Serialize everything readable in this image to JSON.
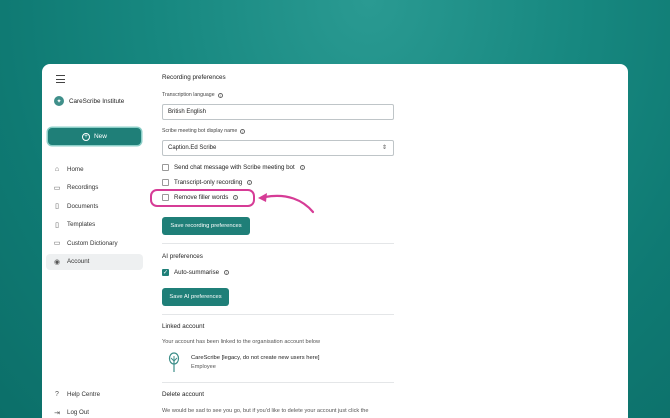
{
  "sidebar": {
    "org_name": "CareScribe Institute",
    "new_button": "New",
    "items": [
      {
        "label": "Home",
        "icon": "home-icon",
        "glyph": "⌂"
      },
      {
        "label": "Recordings",
        "icon": "folder-icon",
        "glyph": "▭"
      },
      {
        "label": "Documents",
        "icon": "document-icon",
        "glyph": "▯"
      },
      {
        "label": "Templates",
        "icon": "template-icon",
        "glyph": "▯"
      },
      {
        "label": "Custom Dictionary",
        "icon": "dictionary-icon",
        "glyph": "▭"
      },
      {
        "label": "Account",
        "icon": "account-icon",
        "glyph": "◉"
      }
    ],
    "bottom_items": [
      {
        "label": "Help Centre",
        "icon": "help-icon",
        "glyph": "?"
      },
      {
        "label": "Log Out",
        "icon": "logout-icon",
        "glyph": "⇥"
      }
    ]
  },
  "recording": {
    "title": "Recording preferences",
    "language_label": "Transcription language",
    "language_value": "British English",
    "bot_name_label": "Scribe meeting bot display name",
    "bot_name_value": "Caption.Ed Scribe",
    "options": [
      {
        "label": "Send chat message with Scribe meeting bot",
        "checked": false
      },
      {
        "label": "Transcript-only recording",
        "checked": false
      },
      {
        "label": "Remove filler words",
        "checked": false
      }
    ],
    "save_button": "Save recording preferences"
  },
  "ai": {
    "title": "AI preferences",
    "auto_summarise": "Auto-summarise",
    "save_button": "Save AI preferences"
  },
  "linked": {
    "title": "Linked account",
    "description": "Your account has been linked to the organisation account below",
    "org_name": "CareScribe [legacy, do not create new users here]",
    "role": "Employee"
  },
  "delete": {
    "title": "Delete account",
    "description": "We would be sad to see you go, but if you'd like to delete your account just click the"
  },
  "colors": {
    "accent": "#1f7f78",
    "highlight": "#d63c96"
  }
}
